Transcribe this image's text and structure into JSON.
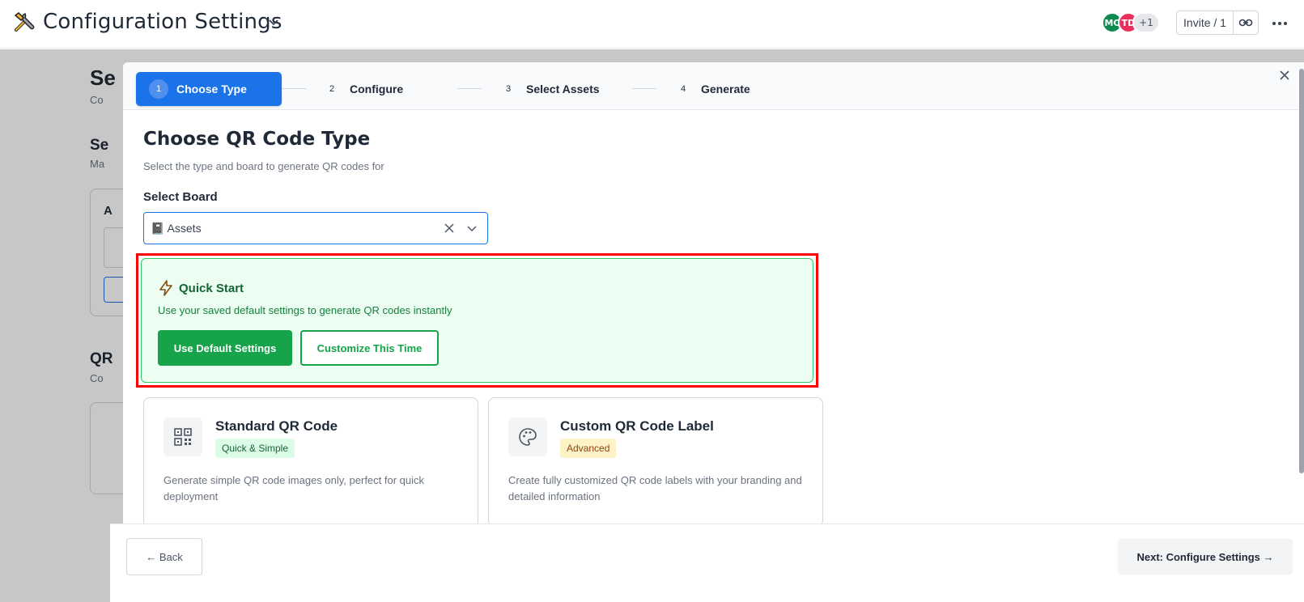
{
  "app": {
    "title": "Configuration Settings",
    "icon": "tools-icon"
  },
  "header": {
    "avatars": [
      "MC",
      "TD",
      "+1"
    ],
    "invite_label": "Invite / 1"
  },
  "background": {
    "heading_1": "Se",
    "sub_1": "Co",
    "heading_2": "Se",
    "sub_2": "Ma",
    "card_letter": "A",
    "heading_3": "QR",
    "sub_3": "Co"
  },
  "wizard": {
    "steps": [
      {
        "num": "1",
        "label": "Choose Type",
        "active": true
      },
      {
        "num": "2",
        "label": "Configure",
        "active": false
      },
      {
        "num": "3",
        "label": "Select Assets",
        "active": false
      },
      {
        "num": "4",
        "label": "Generate",
        "active": false
      }
    ],
    "title": "Choose QR Code Type",
    "subtitle": "Select the type and board to generate QR codes for",
    "select_label": "Select Board",
    "select_value": "📓 Assets",
    "quick_start": {
      "title": "Quick Start",
      "description": "Use your saved default settings to generate QR codes instantly",
      "primary_button": "Use Default Settings",
      "secondary_button": "Customize This Time"
    },
    "types": [
      {
        "title": "Standard QR Code",
        "badge": "Quick & Simple",
        "description": "Generate simple QR code images only, perfect for quick deployment",
        "icon": "qr-code-icon"
      },
      {
        "title": "Custom QR Code Label",
        "badge": "Advanced",
        "description": "Create fully customized QR code labels with your branding and detailed information",
        "icon": "palette-icon"
      }
    ]
  },
  "footer": {
    "back_label": "← Back",
    "next_label": "Next: Configure Settings →"
  },
  "colors": {
    "primary": "#1a73e8",
    "success": "#16a34a",
    "highlight": "#ff0000"
  }
}
